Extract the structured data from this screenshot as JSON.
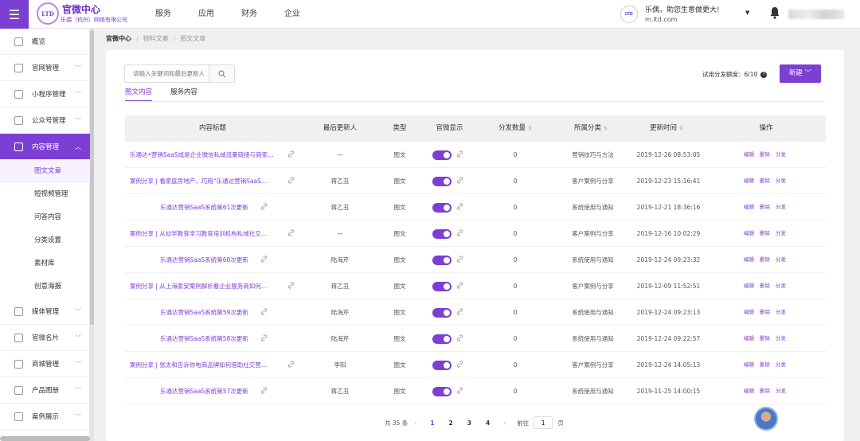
{
  "topbar": {
    "logo_text": "LTD",
    "brand_title": "官微中心",
    "brand_sub": "乐偶（杭州）网络有限公司",
    "nav": [
      "服务",
      "应用",
      "财务",
      "企业"
    ],
    "greeting": "乐偶，助您生意做更大!",
    "domain": "m.ltd.com",
    "avatar_text": "LTD"
  },
  "sidebar": {
    "items": [
      {
        "label": "概览",
        "top": 0
      },
      {
        "label": "官网管理"
      },
      {
        "label": "小程序管理"
      },
      {
        "label": "公众号管理"
      },
      {
        "label": "内容管理"
      }
    ],
    "sub_items": [
      "图文文章",
      "短视频管理",
      "问答内容",
      "分类设置",
      "素材库",
      "创意海报"
    ],
    "bottom_items": [
      "媒体管理",
      "官微名片",
      "商城管理",
      "产品图册",
      "案例展示"
    ]
  },
  "breadcrumb": [
    "官微中心",
    "物料文案",
    "图文文章"
  ],
  "search": {
    "placeholder": "请输入关键词和最后更新人"
  },
  "tabs": [
    "图文内容",
    "服务内容"
  ],
  "quota": {
    "label": "试用分发额度：6/10"
  },
  "new_button": "新建",
  "table": {
    "headers": [
      "内容标题",
      "最后更新人",
      "类型",
      "官微显示",
      "分发数量",
      "所属分类",
      "更新时间",
      "操作"
    ],
    "ops": [
      "编辑",
      "删除",
      "分发"
    ],
    "rows": [
      {
        "title": "乐通达•营销SaaS成是企业微信私域流量链接与商家…",
        "updater": "—",
        "type": "图文",
        "count": "0",
        "category": "营销技巧与方法",
        "time": "2019-12-26 08:53:05",
        "indent": false
      },
      {
        "title": "案例分享 | 看家庭房地产，巧用“乐通达营销SaaS…",
        "updater": "蒋乙丑",
        "type": "图文",
        "count": "0",
        "category": "客户案例与分享",
        "time": "2019-12-23 15:16:41",
        "indent": false
      },
      {
        "title": "乐通达营销SaaS系统第61次更新",
        "updater": "蒋乙丑",
        "type": "图文",
        "count": "0",
        "category": "系统使用与通知",
        "time": "2019-12-21 18:36:16",
        "indent": true
      },
      {
        "title": "案例分享 | 从幼学教育学习教育培训机构私域社交…",
        "updater": "—",
        "type": "图文",
        "count": "0",
        "category": "客户案例与分享",
        "time": "2019-12-16 10:02:29",
        "indent": false
      },
      {
        "title": "乐通达营销SaaS系统第60次更新",
        "updater": "陆海芹",
        "type": "图文",
        "count": "0",
        "category": "系统使用与通知",
        "time": "2019-12-24 09:23:32",
        "indent": true
      },
      {
        "title": "案例分享 | 从上海家安案例解析看企业服务商如何…",
        "updater": "蒋乙丑",
        "type": "图文",
        "count": "0",
        "category": "客户案例与分享",
        "time": "2019-12-09 11:52:51",
        "indent": false
      },
      {
        "title": "乐通达营销SaaS系统第59次更新",
        "updater": "陆海芹",
        "type": "图文",
        "count": "0",
        "category": "系统使用与通知",
        "time": "2019-12-24 09:23:13",
        "indent": true
      },
      {
        "title": "乐通达营销SaaS系统第58次更新",
        "updater": "陆海芹",
        "type": "图文",
        "count": "0",
        "category": "系统使用与通知",
        "time": "2019-12-24 09:22:57",
        "indent": true
      },
      {
        "title": "案例分享 | 张太和告诉你电商品牌如何借助社交营…",
        "updater": "李阳",
        "type": "图文",
        "count": "0",
        "category": "客户案例与分享",
        "time": "2019-12-24 14:05:13",
        "indent": false
      },
      {
        "title": "乐通达营销SaaS系统第57次更新",
        "updater": "蒋乙丑",
        "type": "图文",
        "count": "0",
        "category": "系统使用与通知",
        "time": "2019-11-25 14:00:15",
        "indent": true
      }
    ]
  },
  "pagination": {
    "total": "共 35 条",
    "prev": "‹",
    "pages": [
      "1",
      "2",
      "3",
      "4"
    ],
    "next": "›",
    "jump_label": "前往",
    "jump_value": "1",
    "page_unit": "页"
  }
}
